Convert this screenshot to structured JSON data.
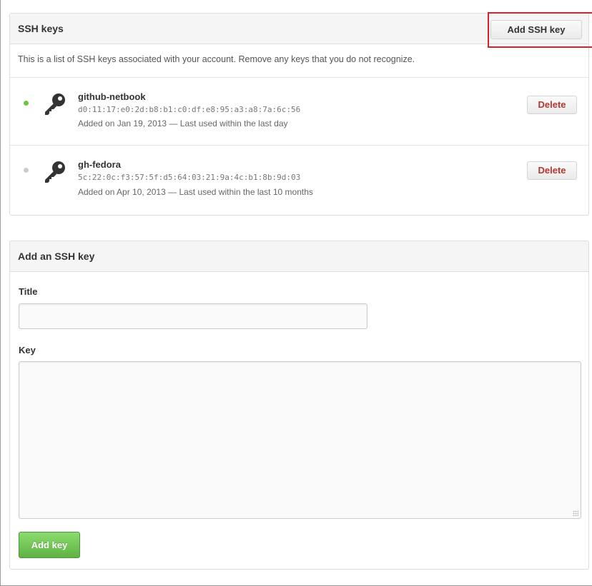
{
  "ssh_keys_panel": {
    "title": "SSH keys",
    "add_button_label": "Add SSH key",
    "intro": "This is a list of SSH keys associated with your account. Remove any keys that you do not recognize.",
    "keys": [
      {
        "name": "github-netbook",
        "fingerprint": "d0:11:17:e0:2d:b8:b1:c0:df:e8:95:a3:a8:7a:6c:56",
        "meta": "Added on Jan 19, 2013 — Last used within the last day",
        "status_color": "#6cc644",
        "delete_label": "Delete"
      },
      {
        "name": "gh-fedora",
        "fingerprint": "5c:22:0c:f3:57:5f:d5:64:03:21:9a:4c:b1:8b:9d:03",
        "meta": "Added on Apr 10, 2013 — Last used within the last 10 months",
        "status_color": "#cccccc",
        "delete_label": "Delete"
      }
    ]
  },
  "add_key_form": {
    "title": "Add an SSH key",
    "title_label": "Title",
    "title_value": "",
    "key_label": "Key",
    "key_value": "",
    "submit_label": "Add key"
  },
  "colors": {
    "highlight_box": "#d8232a",
    "delete_text": "#b33630",
    "add_key_green": "#60b044"
  }
}
